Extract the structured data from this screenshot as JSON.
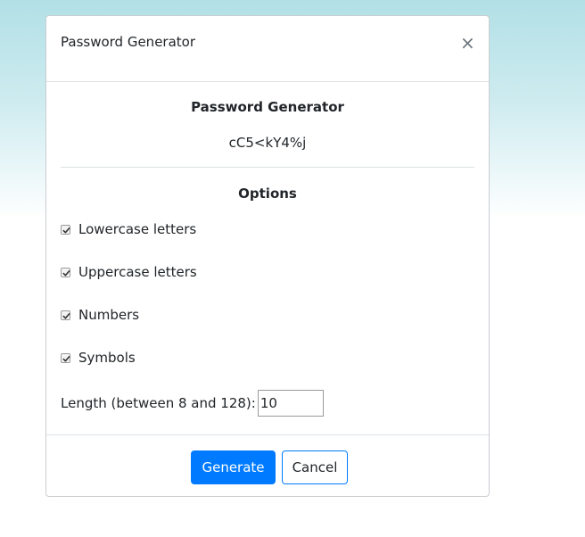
{
  "modal": {
    "title": "Password Generator",
    "close_symbol": "×"
  },
  "generator": {
    "heading": "Password Generator",
    "password": "cC5<kY4%j"
  },
  "options": {
    "heading": "Options",
    "items": [
      {
        "label": "Lowercase letters",
        "checked": true
      },
      {
        "label": "Uppercase letters",
        "checked": true
      },
      {
        "label": "Numbers",
        "checked": true
      },
      {
        "label": "Symbols",
        "checked": true
      }
    ],
    "length_label": "Length (between 8 and 128):",
    "length_value": "10"
  },
  "footer": {
    "generate_label": "Generate",
    "cancel_label": "Cancel"
  },
  "colors": {
    "primary": "#007bff",
    "background_top": "#b1e0e6"
  },
  "icons": {
    "close": "close-icon",
    "checkbox": "checkmark-icon"
  }
}
